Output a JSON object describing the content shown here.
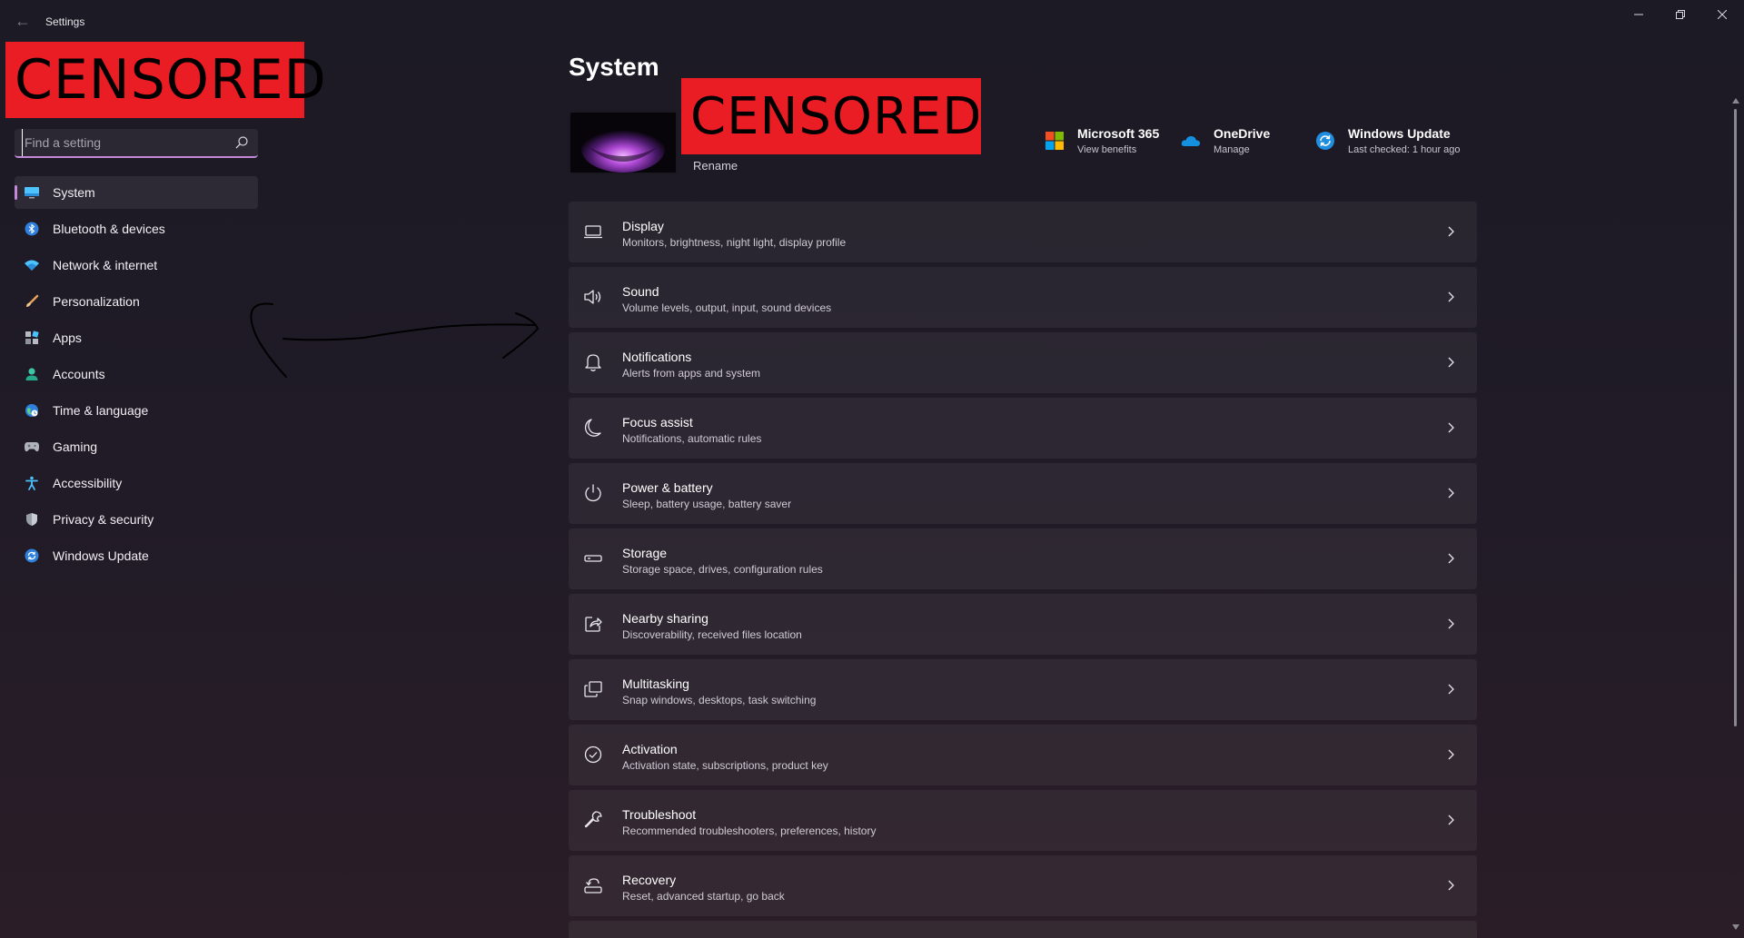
{
  "window": {
    "title": "Settings"
  },
  "censor": {
    "left": "CENSORED",
    "right": "CENSORED"
  },
  "search": {
    "placeholder": "Find a setting",
    "value": ""
  },
  "sidebar": {
    "items": [
      {
        "label": "System",
        "icon": "system-icon",
        "active": true
      },
      {
        "label": "Bluetooth & devices",
        "icon": "bluetooth-icon"
      },
      {
        "label": "Network & internet",
        "icon": "wifi-icon"
      },
      {
        "label": "Personalization",
        "icon": "brush-icon"
      },
      {
        "label": "Apps",
        "icon": "apps-icon"
      },
      {
        "label": "Accounts",
        "icon": "account-icon"
      },
      {
        "label": "Time & language",
        "icon": "globe-clock-icon"
      },
      {
        "label": "Gaming",
        "icon": "gamepad-icon"
      },
      {
        "label": "Accessibility",
        "icon": "accessibility-icon"
      },
      {
        "label": "Privacy & security",
        "icon": "shield-icon"
      },
      {
        "label": "Windows Update",
        "icon": "update-icon"
      }
    ]
  },
  "main": {
    "title": "System",
    "device": {
      "rename_label": "Rename"
    },
    "quick_links": [
      {
        "title": "Microsoft 365",
        "subtitle": "View benefits",
        "icon": "microsoft-365-icon"
      },
      {
        "title": "OneDrive",
        "subtitle": "Manage",
        "icon": "onedrive-icon"
      },
      {
        "title": "Windows Update",
        "subtitle": "Last checked: 1 hour ago",
        "icon": "windows-update-icon"
      }
    ],
    "settings": [
      {
        "title": "Display",
        "subtitle": "Monitors, brightness, night light, display profile",
        "icon": "display-icon"
      },
      {
        "title": "Sound",
        "subtitle": "Volume levels, output, input, sound devices",
        "icon": "speaker-icon"
      },
      {
        "title": "Notifications",
        "subtitle": "Alerts from apps and system",
        "icon": "bell-icon"
      },
      {
        "title": "Focus assist",
        "subtitle": "Notifications, automatic rules",
        "icon": "moon-icon"
      },
      {
        "title": "Power & battery",
        "subtitle": "Sleep, battery usage, battery saver",
        "icon": "power-icon"
      },
      {
        "title": "Storage",
        "subtitle": "Storage space, drives, configuration rules",
        "icon": "storage-icon"
      },
      {
        "title": "Nearby sharing",
        "subtitle": "Discoverability, received files location",
        "icon": "share-icon"
      },
      {
        "title": "Multitasking",
        "subtitle": "Snap windows, desktops, task switching",
        "icon": "multitasking-icon"
      },
      {
        "title": "Activation",
        "subtitle": "Activation state, subscriptions, product key",
        "icon": "check-circle-icon"
      },
      {
        "title": "Troubleshoot",
        "subtitle": "Recommended troubleshooters, preferences, history",
        "icon": "wrench-icon"
      },
      {
        "title": "Recovery",
        "subtitle": "Reset, advanced startup, go back",
        "icon": "recovery-icon"
      }
    ]
  },
  "colors": {
    "accent": "#c389d8",
    "censor": "#ea1c24",
    "background": "#1e1b25"
  }
}
